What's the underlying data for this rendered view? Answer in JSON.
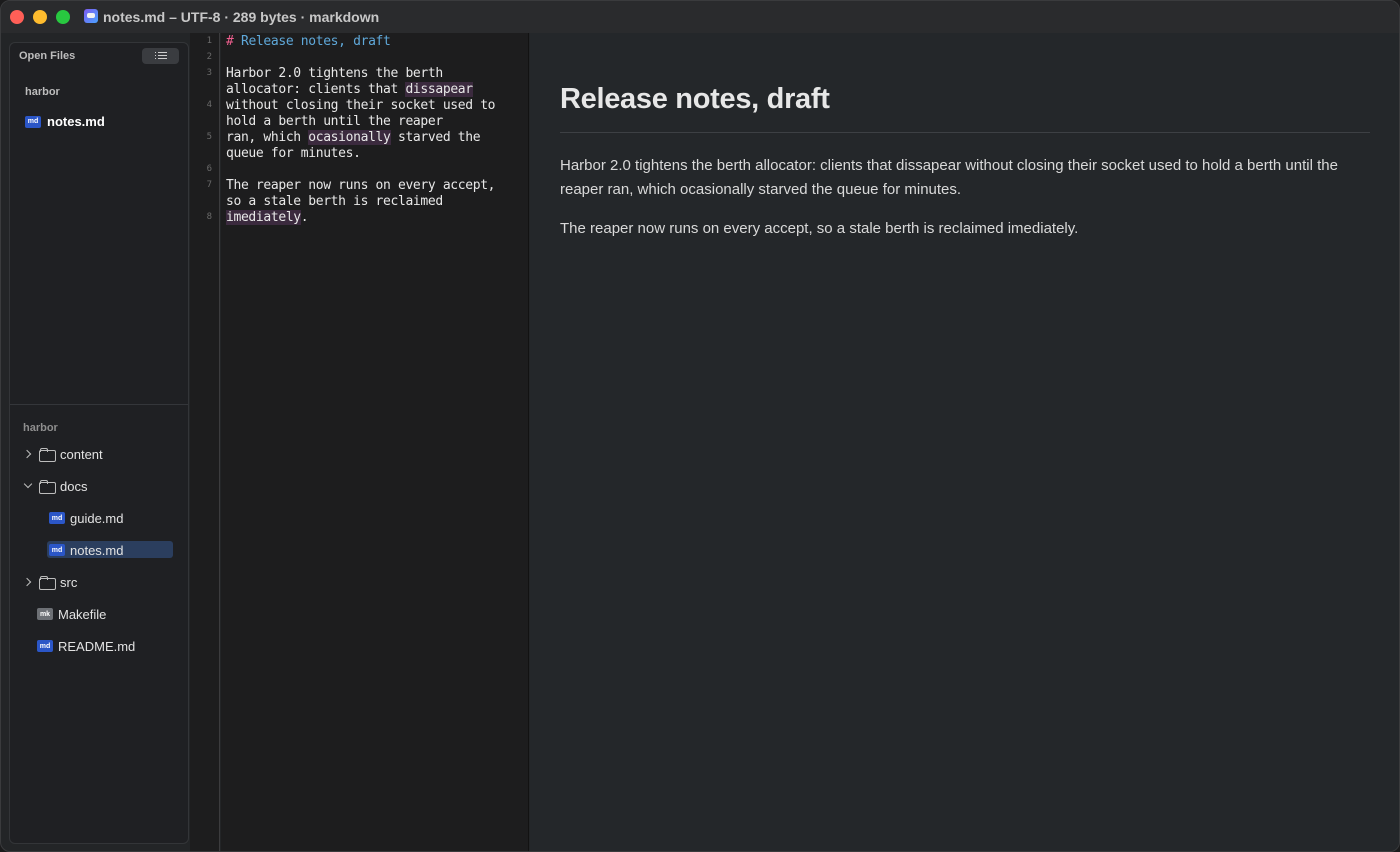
{
  "window": {
    "title": "notes.md – UTF-8 · 289 bytes · markdown"
  },
  "sidebar": {
    "open_files_label": "Open Files",
    "open_group_label": "harbor",
    "open_file": {
      "icon": "md",
      "name": "notes.md"
    },
    "tree_root_label": "harbor",
    "tree": [
      {
        "type": "folder",
        "name": "content",
        "expanded": false
      },
      {
        "type": "folder",
        "name": "docs",
        "expanded": true
      },
      {
        "type": "file",
        "icon": "md",
        "name": "guide.md"
      },
      {
        "type": "file",
        "icon": "md",
        "name": "notes.md",
        "selected": true
      },
      {
        "type": "folder",
        "name": "src",
        "expanded": false
      },
      {
        "type": "file",
        "icon": "mk",
        "name": "Makefile"
      },
      {
        "type": "file",
        "icon": "md",
        "name": "README.md"
      }
    ]
  },
  "editor": {
    "line_numbers": [
      "1",
      "2",
      "3",
      "4",
      "5",
      "6",
      "7",
      "8"
    ],
    "heading_marker": "#",
    "heading_text": " Release notes, draft",
    "l3": "Harbor 2.0 tightens the berth",
    "l4a": "allocator: clients that ",
    "l4b": "dissapear",
    "l5": "without closing their socket used to",
    "l6": "hold a berth until the reaper",
    "l7a": "ran, which ",
    "l7b": "ocasionally",
    "l7c": " starved the",
    "l8": "queue for minutes.",
    "l9": "The reaper now runs on every accept,",
    "l10": "so a stale berth is reclaimed",
    "l11a": "imediately",
    "l11b": "."
  },
  "preview": {
    "h1": "Release notes, draft",
    "p1": "Harbor 2.0 tightens the berth allocator: clients that dissapear without closing their socket used to hold a berth until the reaper ran, which ocasionally starved the queue for minutes.",
    "p2": "The reaper now runs on every accept, so a stale berth is reclaimed imediately."
  },
  "colors": {
    "accent_selection": "#2b3e5e",
    "markdown_badge": "#2b56c7",
    "spell_highlight": "#3b2a3e",
    "heading_marker": "#ef5f8f",
    "heading_text": "#5fa8d9"
  }
}
